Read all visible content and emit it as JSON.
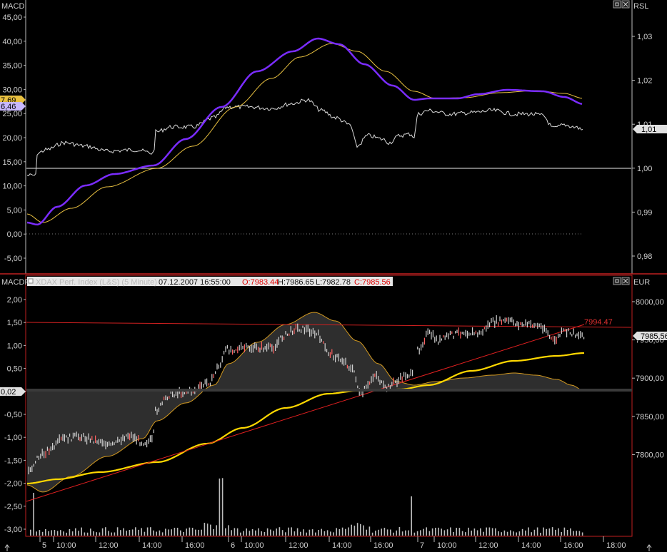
{
  "upper_panel": {
    "left_title": "MACD",
    "right_title": "RSL",
    "left_ticks": [
      "45,00",
      "40,00",
      "35,00",
      "30,00",
      "25,00",
      "20,00",
      "15,00",
      "10,00",
      "5,00",
      "0,00",
      "-5,00"
    ],
    "right_ticks": [
      "1,03",
      "1,02",
      "1,01",
      "1,00",
      "0,99",
      "0,98"
    ],
    "left_markers": [
      "7,69",
      "6,46"
    ],
    "right_marker": "1,01"
  },
  "lower_panel": {
    "left_title": "MACDF",
    "right_title": "EUR",
    "header": {
      "name": "XDAX Perf. Index (L&S) (5 Minute)",
      "datetime": "07.12.2007 16:55:00",
      "open": "O:7983.44",
      "high": "H:7986.65",
      "low": "L:7982.78",
      "close": "C:7985.56"
    },
    "left_ticks": [
      "2,00",
      "1,50",
      "1,00",
      "0,50",
      "0,00",
      "-0,50",
      "-1,00",
      "-1,50",
      "-2,00",
      "-2,50",
      "-3,00"
    ],
    "right_ticks": [
      "8000,00",
      "7950,00",
      "7900,00",
      "7850,00",
      "7800,00"
    ],
    "left_marker": "0,02",
    "right_marker": "7985,56",
    "resistance_label": "7994.47"
  },
  "time_axis": {
    "labels": [
      "5",
      "10:00",
      "12:00",
      "14:00",
      "16:00",
      "6",
      "10:00",
      "12:00",
      "14:00",
      "16:00",
      "7",
      "10:00",
      "12:00",
      "14:00",
      "16:00",
      "18:00"
    ]
  },
  "colors": {
    "background": "#000000",
    "price_bars": "#d0d0d0",
    "macd_line": "#7a2cff",
    "signal_line": "#e8c040",
    "rsl_line": "#d8d8d8",
    "moving_average": "#ffd800",
    "trend_lines": "#e02020",
    "panel_border": "#c02020"
  },
  "icons": {
    "window_buttons": [
      "restore-icon",
      "close-icon"
    ],
    "scroll_arrows": [
      "arrow-up-icon",
      "arrow-up-icon"
    ]
  }
}
